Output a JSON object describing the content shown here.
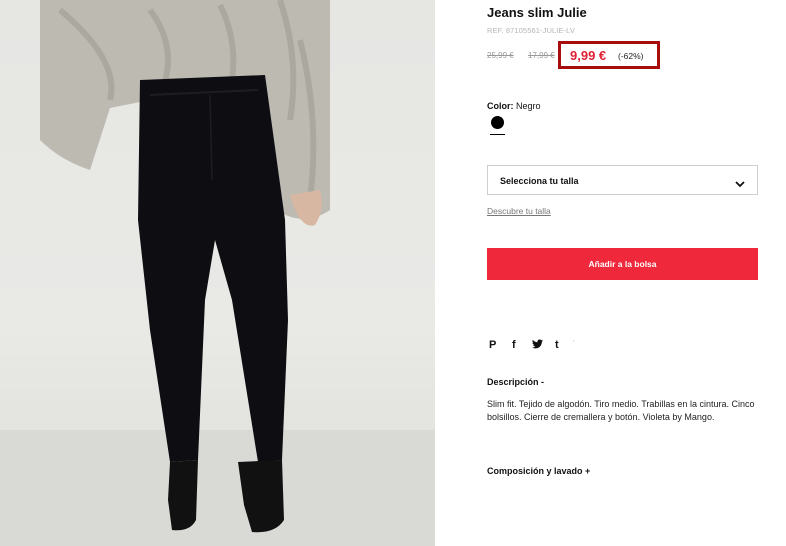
{
  "product": {
    "title": "Jeans slim Julie",
    "ref": "REF. 87105561-JULIE-LV",
    "price_original": "25,99 €",
    "price_previous": "17,99 €",
    "price_current": "9,99 €",
    "discount": "(-62%)"
  },
  "color": {
    "label": "Color:",
    "value": "Negro",
    "swatch_color": "#000000"
  },
  "size": {
    "select_label": "Selecciona tu talla",
    "guide_link": "Descubre tu talla"
  },
  "actions": {
    "add_to_bag": "Añadir a la bolsa"
  },
  "share": {
    "icons": [
      "pinterest-icon",
      "facebook-icon",
      "twitter-icon",
      "tumblr-icon"
    ],
    "glyphs": [
      "P",
      "f",
      "t",
      "t"
    ]
  },
  "description": {
    "heading": "Descripción",
    "toggle": "-",
    "text": "Slim fit. Tejido de algodón. Tiro medio. Trabillas en la cintura. Cinco bolsillos. Cierre de cremallera y botón. Violeta by Mango."
  },
  "composition": {
    "heading": "Composición y lavado",
    "toggle": "+"
  },
  "colors": {
    "accent_red": "#f0283b",
    "price_red": "#e02034",
    "highlight_border": "#a80d0d"
  }
}
